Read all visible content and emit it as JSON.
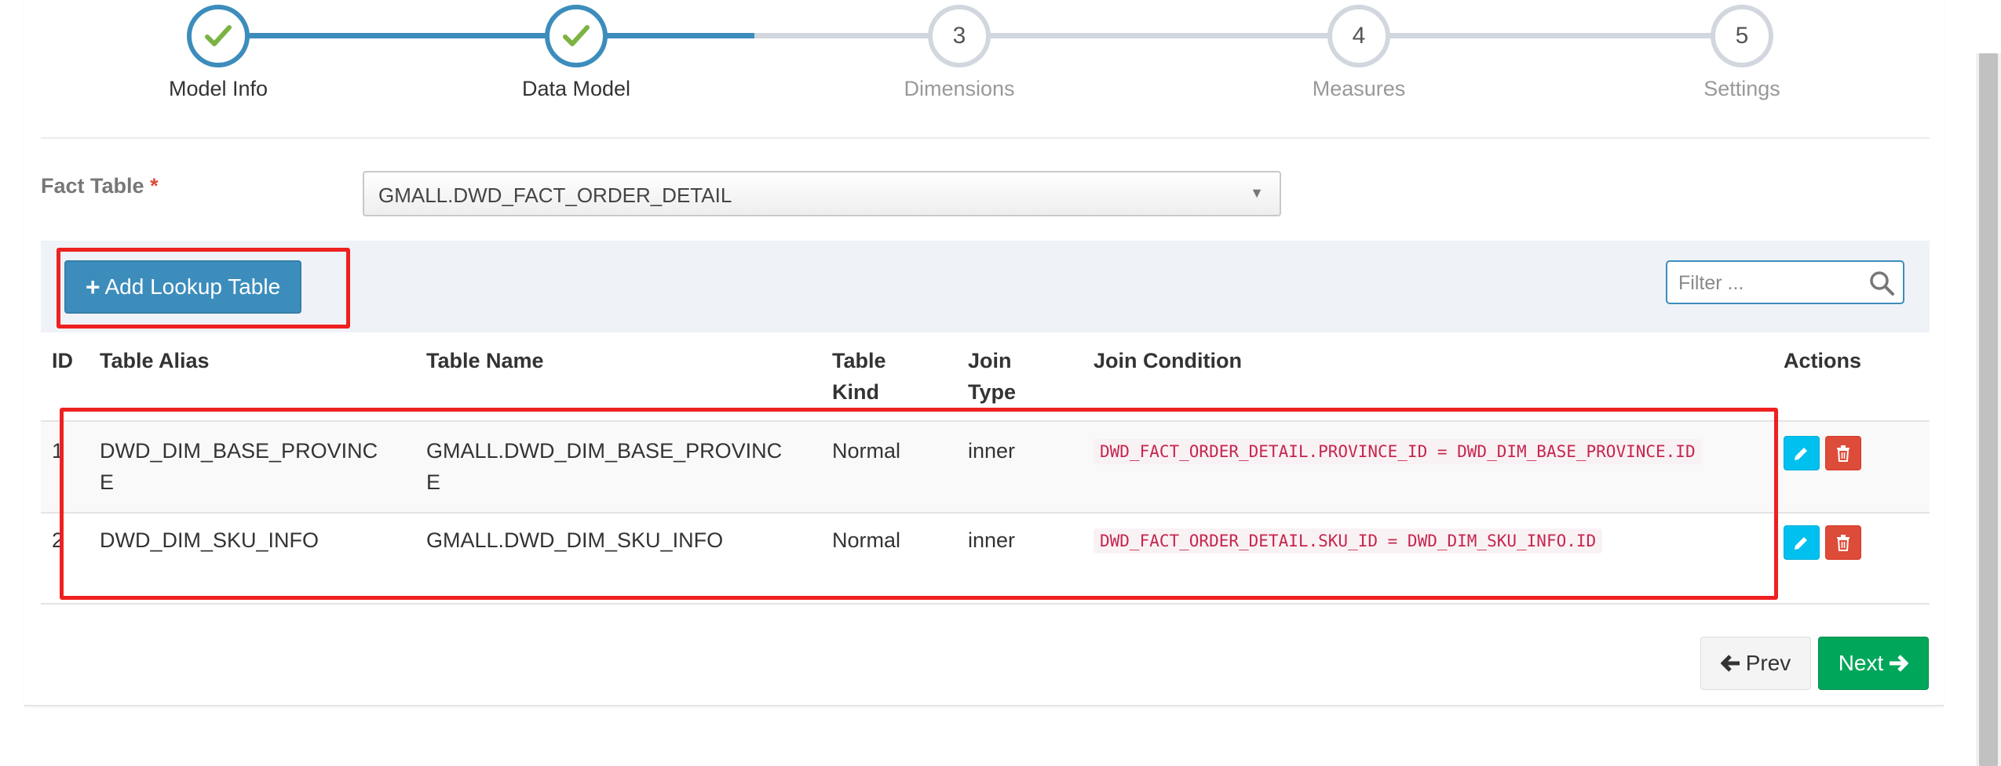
{
  "wizard": {
    "steps": [
      {
        "label": "Model Info",
        "number": "",
        "status": "done"
      },
      {
        "label": "Data Model",
        "number": "",
        "status": "done"
      },
      {
        "label": "Dimensions",
        "number": "3",
        "status": "pending"
      },
      {
        "label": "Measures",
        "number": "4",
        "status": "pending"
      },
      {
        "label": "Settings",
        "number": "5",
        "status": "pending"
      }
    ]
  },
  "fact_table": {
    "label": "Fact Table",
    "required_mark": "*",
    "selected": "GMALL.DWD_FACT_ORDER_DETAIL"
  },
  "toolbar": {
    "add_label": "Add Lookup Table",
    "filter_placeholder": "Filter ..."
  },
  "table": {
    "headers": {
      "id": "ID",
      "alias": "Table Alias",
      "name": "Table Name",
      "kind_1": "Table",
      "kind_2": "Kind",
      "join_1": "Join",
      "join_2": "Type",
      "condition": "Join Condition",
      "actions": "Actions"
    },
    "rows": [
      {
        "id": "1",
        "alias_1": "DWD_DIM_BASE_PROVINC",
        "alias_2": "E",
        "name_1": "GMALL.DWD_DIM_BASE_PROVINC",
        "name_2": "E",
        "kind": "Normal",
        "join": "inner",
        "condition": "DWD_FACT_ORDER_DETAIL.PROVINCE_ID = DWD_DIM_BASE_PROVINCE.ID"
      },
      {
        "id": "2",
        "alias_1": "DWD_DIM_SKU_INFO",
        "alias_2": "",
        "name_1": "GMALL.DWD_DIM_SKU_INFO",
        "name_2": "",
        "kind": "Normal",
        "join": "inner",
        "condition": "DWD_FACT_ORDER_DETAIL.SKU_ID = DWD_DIM_SKU_INFO.ID"
      }
    ]
  },
  "nav": {
    "prev_label": "Prev",
    "next_label": "Next"
  },
  "colors": {
    "primary": "#3c8dbc",
    "success": "#00a65a",
    "info": "#00c0ef",
    "danger": "#dd4b39",
    "check": "#7cb342",
    "highlight_box": "#ee2020"
  },
  "icons": {
    "step_done": "check-icon",
    "add": "plus-icon",
    "filter": "search-icon",
    "edit": "pencil-icon",
    "delete": "trash-icon",
    "prev": "arrow-left-icon",
    "next": "arrow-right-icon",
    "select": "caret-down-icon"
  }
}
